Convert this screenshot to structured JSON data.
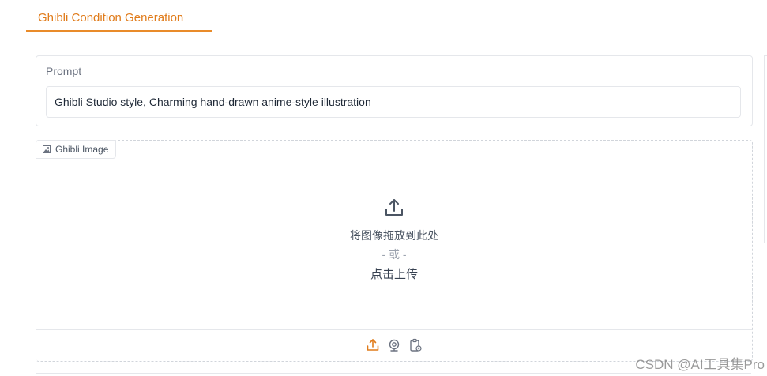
{
  "tabs": [
    {
      "label": "Ghibli Condition Generation",
      "active": true
    }
  ],
  "prompt": {
    "label": "Prompt",
    "value": "Ghibli Studio style, Charming hand-drawn anime-style illustration"
  },
  "image_input": {
    "label": "Ghibli Image",
    "label_icon": "image-icon",
    "drop_text": "将图像拖放到此处",
    "or_text": "- 或 -",
    "click_text": "点击上传",
    "toolbar_icons": [
      "upload-icon",
      "webcam-icon",
      "clipboard-icon"
    ]
  },
  "watermark": "CSDN @AI工具集Pro",
  "colors": {
    "accent": "#e07b1a",
    "border": "#e5e7eb",
    "text": "#374151",
    "muted": "#9ca3af"
  }
}
